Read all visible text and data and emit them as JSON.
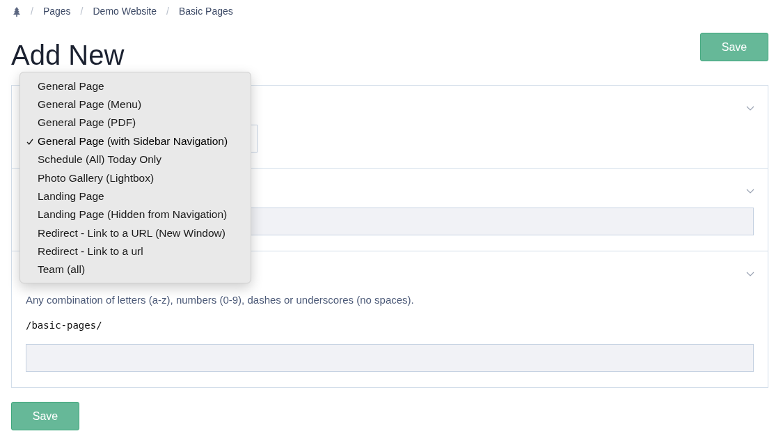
{
  "breadcrumb": [
    {
      "separator": "/",
      "label": "Pages"
    },
    {
      "separator": "/",
      "label": "Demo Website"
    },
    {
      "separator": "/",
      "label": "Basic Pages"
    }
  ],
  "title": "Add New",
  "save_top": "Save",
  "sections": [
    {
      "kind": "select",
      "expanded": true
    },
    {
      "kind": "input",
      "expanded": true
    },
    {
      "kind": "slug",
      "expanded": true,
      "help": "Any combination of letters (a-z), numbers (0-9), dashes or underscores (no spaces).",
      "prefix": "/basic-pages/"
    }
  ],
  "dropdown": {
    "options": [
      {
        "label": "General Page",
        "selected": false
      },
      {
        "label": "General Page (Menu)",
        "selected": false
      },
      {
        "label": "General Page (PDF)",
        "selected": false
      },
      {
        "label": "General Page (with Sidebar Navigation)",
        "selected": true
      },
      {
        "label": "Schedule (All) Today Only",
        "selected": false
      },
      {
        "label": "Photo Gallery (Lightbox)",
        "selected": false
      },
      {
        "label": "Landing Page",
        "selected": false
      },
      {
        "label": "Landing Page (Hidden from Navigation)",
        "selected": false
      },
      {
        "label": "Redirect - Link to a URL (New Window)",
        "selected": false
      },
      {
        "label": "Redirect - Link to a url",
        "selected": false
      },
      {
        "label": "Team (all)",
        "selected": false
      }
    ]
  },
  "save_bottom": "Save"
}
